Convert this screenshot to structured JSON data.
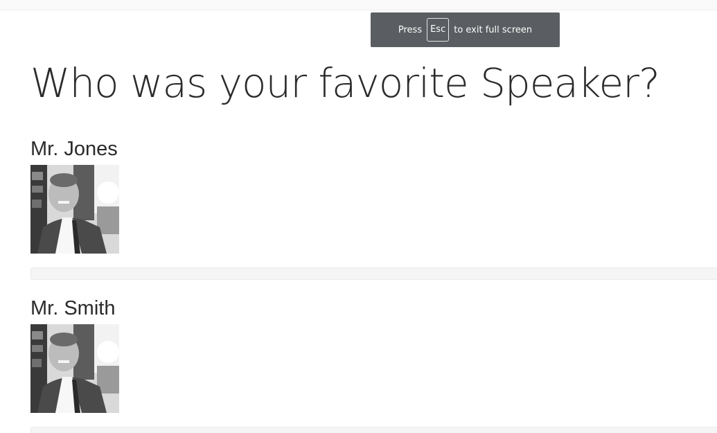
{
  "fullscreen_notice": {
    "press": "Press",
    "key": "Esc",
    "message": "to exit full screen"
  },
  "poll": {
    "question": "Who was your favorite Speaker?",
    "options": [
      {
        "name": "Mr. Jones",
        "photo_icon": "speaker-photo"
      },
      {
        "name": "Mr. Smith",
        "photo_icon": "speaker-photo"
      }
    ]
  }
}
